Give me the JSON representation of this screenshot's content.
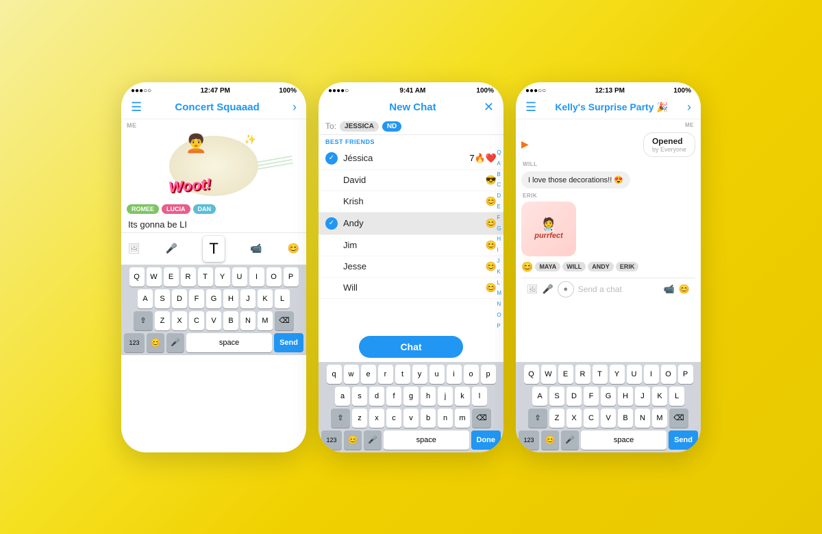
{
  "background": {
    "gradient_start": "#f7f0a0",
    "gradient_end": "#e8c800"
  },
  "phone1": {
    "status": {
      "left": "●●●○○",
      "time": "12:47 PM",
      "right": "100%"
    },
    "header": {
      "title": "Concert Squaaad",
      "left_icon": "menu",
      "right_icon": "chevron-right"
    },
    "me_label": "ME",
    "woot_text": "woot!",
    "tags": [
      "ROMEE",
      "LUCIA",
      "DAN"
    ],
    "typed_text": "Its gonna be LI",
    "keyboard": {
      "rows": [
        [
          "Q",
          "W",
          "E",
          "R",
          "T",
          "Y",
          "U",
          "I",
          "O",
          "P"
        ],
        [
          "A",
          "S",
          "D",
          "F",
          "G",
          "H",
          "J",
          "K",
          "L"
        ],
        [
          "⇧",
          "Z",
          "X",
          "C",
          "V",
          "B",
          "N",
          "M",
          "⌫"
        ],
        [
          "123",
          "😊",
          "🎤",
          "space",
          "Send"
        ]
      ],
      "send_label": "Send",
      "space_label": "space"
    }
  },
  "phone2": {
    "status": {
      "left": "●●●●○",
      "time": "9:41 AM",
      "right": "100%"
    },
    "header": {
      "title": "New Chat",
      "close_icon": "✕"
    },
    "to_label": "To:",
    "to_chips": [
      "JESSICA",
      "ND"
    ],
    "best_friends_label": "BEST FRIENDS",
    "contacts": [
      {
        "name": "Jéssica",
        "emoji": "7🔥❤️",
        "selected": true
      },
      {
        "name": "David",
        "emoji": "😎",
        "selected": false
      },
      {
        "name": "Krish",
        "emoji": "😊",
        "selected": false
      },
      {
        "name": "Andy",
        "emoji": "😊",
        "selected": true
      },
      {
        "name": "Jim",
        "emoji": "😊",
        "selected": false
      },
      {
        "name": "Jesse",
        "emoji": "😊",
        "selected": false
      },
      {
        "name": "Will",
        "emoji": "😊",
        "selected": false
      }
    ],
    "alpha_index": [
      "Q",
      "A",
      "B",
      "C",
      "D",
      "E",
      "F",
      "G",
      "H",
      "I",
      "J",
      "K",
      "L",
      "M",
      "N",
      "O",
      "P"
    ],
    "chat_button": "Chat",
    "keyboard": {
      "rows": [
        [
          "q",
          "w",
          "e",
          "r",
          "t",
          "y",
          "u",
          "i",
          "o",
          "p"
        ],
        [
          "a",
          "s",
          "d",
          "f",
          "g",
          "h",
          "j",
          "k",
          "l"
        ],
        [
          "⇧",
          "z",
          "x",
          "c",
          "v",
          "b",
          "n",
          "m",
          "⌫"
        ],
        [
          "123",
          "😊",
          "🎤",
          "space",
          "Done"
        ]
      ],
      "done_label": "Done",
      "space_label": "space"
    }
  },
  "phone3": {
    "status": {
      "left": "●●●○○",
      "time": "12:13 PM",
      "right": "100%"
    },
    "header": {
      "title": "Kelly's Surprise Party 🎉",
      "left_icon": "menu",
      "right_icon": "chevron-right"
    },
    "me_label": "ME",
    "opened_label": "Opened",
    "opened_sub": "by Everyone",
    "will_label": "WILL",
    "will_msg": "I love those decorations!! 😍",
    "erik_label": "ERIK",
    "purrfect_text": "purrfect",
    "reactions": [
      "😊",
      "MAYA",
      "WILL",
      "ANDY",
      "ERIK"
    ],
    "send_placeholder": "Send a chat",
    "keyboard": {
      "rows": [
        [
          "Q",
          "W",
          "E",
          "R",
          "T",
          "Y",
          "U",
          "I",
          "O",
          "P"
        ],
        [
          "A",
          "S",
          "D",
          "F",
          "G",
          "H",
          "J",
          "K",
          "L"
        ],
        [
          "⇧",
          "Z",
          "X",
          "C",
          "V",
          "B",
          "N",
          "M",
          "⌫"
        ],
        [
          "123",
          "😊",
          "🎤",
          "space",
          "Send"
        ]
      ],
      "send_label": "Send",
      "space_label": "space"
    }
  }
}
